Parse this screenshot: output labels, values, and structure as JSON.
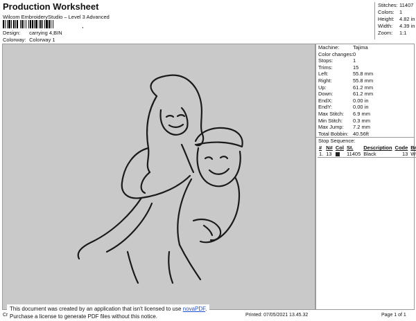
{
  "header": {
    "title": "Production Worksheet",
    "subtitle": "Wilcom EmbroideryStudio – Level 3 Advanced",
    "barcode_suffix": ","
  },
  "meta": {
    "design_label": "Design:",
    "design_value": "carrying 4,BIN",
    "colorway_label": "Colorway:",
    "colorway_value": "Colorway 1"
  },
  "stats_top": [
    {
      "label": "Stitches:",
      "value": "11407"
    },
    {
      "label": "Colors:",
      "value": "1"
    },
    {
      "label": "Height:",
      "value": "4.82 in"
    },
    {
      "label": "Width:",
      "value": "4.39 in"
    },
    {
      "label": "Zoom:",
      "value": "1:1"
    }
  ],
  "machine_info": [
    {
      "label": "Machine:",
      "value": "Tajima"
    },
    {
      "label": "Color changes:",
      "value": "0"
    },
    {
      "label": "Stops:",
      "value": "1"
    },
    {
      "label": "Trims:",
      "value": "15"
    },
    {
      "label": "Left:",
      "value": "55.8 mm"
    },
    {
      "label": "Right:",
      "value": "55.8 mm"
    },
    {
      "label": "Up:",
      "value": "61.2 mm"
    },
    {
      "label": "Down:",
      "value": "61.2 mm"
    },
    {
      "label": "EndX:",
      "value": "0.00 in"
    },
    {
      "label": "EndY:",
      "value": "0.00 in"
    },
    {
      "label": "Max Stitch:",
      "value": "6.9 mm"
    },
    {
      "label": "Min Stitch:",
      "value": "0.3 mm"
    },
    {
      "label": "Max Jump:",
      "value": "7.2 mm"
    },
    {
      "label": "Total Bobbin:",
      "value": "40.56ft"
    }
  ],
  "stop_sequence": {
    "title": "Stop Sequence:",
    "headers": [
      "#",
      "N#",
      "Col",
      "St.",
      "Description",
      "Code",
      "Brand"
    ],
    "rows": [
      {
        "num": "1.",
        "n": "13",
        "st": "11405",
        "description": "Black",
        "code": "13",
        "brand": "Wilcom"
      }
    ]
  },
  "notice": {
    "line1_prefix": "This document was created by an application that isn't licensed to use ",
    "link": "novaPDF",
    "line1_suffix": ".",
    "line2": "Purchase a license to generate PDF files without this notice."
  },
  "footer": {
    "cr": "Cr",
    "printed": "Printed: 07/05/2021 13.45.32",
    "page": "Page 1 of 1"
  },
  "colors": {
    "canvas_bg": "#c9c9c9",
    "thread": "#1a1a1a",
    "link": "#1a4fd6"
  }
}
